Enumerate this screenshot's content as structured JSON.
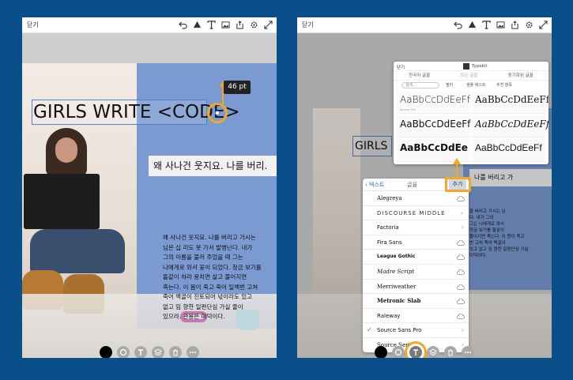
{
  "colors": {
    "background": "#0b4f8a",
    "accent": "#f5a623",
    "panel_blue": "#7b9ad2",
    "link_blue": "#2b6fd9"
  },
  "top_icons": [
    "undo-icon",
    "shape-icon",
    "text-icon",
    "image-icon",
    "share-icon",
    "settings-icon",
    "expand-icon"
  ],
  "left": {
    "close_label": "닫기",
    "headline": "GIRLS WRITE <CODE>",
    "size_badge": "46 pt",
    "subtitle": "왜 사나건 웃지요. 나를 버리.",
    "body": "왜 사나건 웃지요. 나를 버리고 가시는\n님은 십 리도 못 가서 발병난다. 내가\n그의 이름을 불러 주었을 때 그는\n나에게로 와서 꽃이 되었다. 청금 보기를\n돌같이 하라 용치면 살고 풀어지면\n죽는다. 이 몸이 죽고 죽어 일백번 고쳐\n죽어 백골이 진토되어 넋이라도 있고\n없고 임 향한 일편단심 가실 줄이\n있으랴. 관용은 미덕이다."
  },
  "right": {
    "close_label": "닫기",
    "headline": "GIRLS WRI",
    "subtitle": "나를 버리고 가",
    "body": "을 버리고 가시는 님\n다. 내가 그의\n그는 나에게로 와서\n정금 보기를 돌같이\n풀어지면 죽는다. 이 몸이 죽고\n번 고쳐 죽어 백골이\n있고 없고 임 향한 일편단심 가실\n미덕이다.",
    "font_picker": {
      "back_label": "텍스트",
      "title": "글꼴",
      "add_label": "추가",
      "fonts": [
        {
          "name": "Alegreya",
          "action": "cloud"
        },
        {
          "name": "DISCOURSE MIDDLE",
          "action": "chevron"
        },
        {
          "name": "Factoria",
          "action": "chevron"
        },
        {
          "name": "Fira Sans",
          "action": "cloud"
        },
        {
          "name": "League Gothic",
          "action": "cloud"
        },
        {
          "name": "Madre Script",
          "action": "cloud"
        },
        {
          "name": "Merriweather",
          "action": "cloud"
        },
        {
          "name": "Metronic Slab",
          "action": "cloud"
        },
        {
          "name": "Raleway",
          "action": "cloud"
        },
        {
          "name": "Source Sans Pro",
          "action": "chevron",
          "selected": true
        },
        {
          "name": "Source Serif Pro",
          "action": "chevron"
        }
      ]
    },
    "typekit": {
      "close_label": "닫기",
      "brand": "Typekit",
      "tabs": [
        "한국어 글꼴",
        "모든 글꼴",
        "동기화된 글꼴"
      ],
      "search_placeholder": "검색...",
      "filters": [
        "필터",
        "샘플 텍스트",
        "추천 항목"
      ],
      "sample_text": "AaBbCcDdEeFf",
      "samples": [
        {
          "text": "AaBbCcDdEeFf",
          "meta": "Acumin Pro"
        },
        {
          "text": "AaBbCcDdEeFf",
          "meta": ""
        },
        {
          "text": "AaBbCcDdEeFf",
          "meta": ""
        },
        {
          "text": "AaBbCcDdEeFf",
          "meta": ""
        },
        {
          "text": "AaBbCcDdEe",
          "meta": ""
        },
        {
          "text": "AaBbCcDdEeFf",
          "meta": ""
        }
      ]
    }
  }
}
